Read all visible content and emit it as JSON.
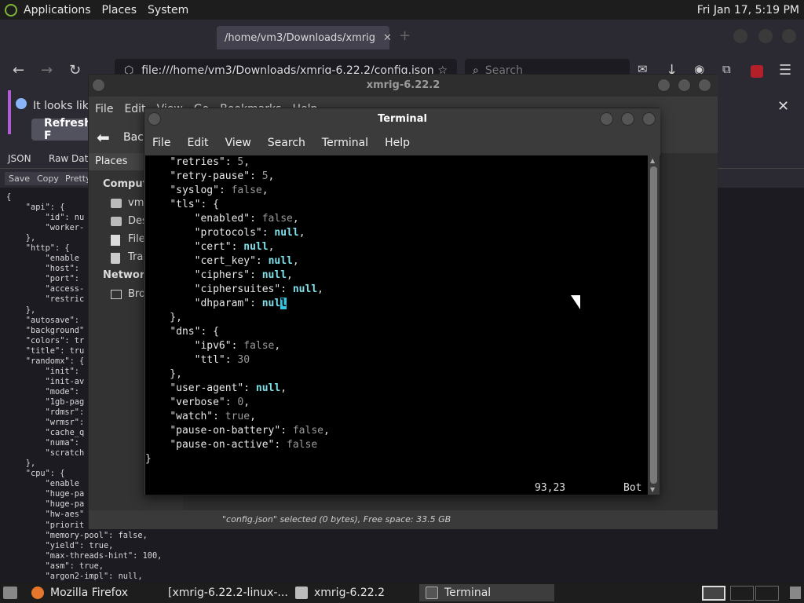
{
  "top_panel": {
    "menus": [
      "Applications",
      "Places",
      "System"
    ],
    "clock": "Fri Jan 17,  5:19 PM"
  },
  "firefox": {
    "tab_title": "/home/vm3/Downloads/xmrig",
    "url": "file:///home/vm3/Downloads/xmrig-6.22.2/config.json",
    "search_placeholder": "Search",
    "notify_text": "It looks like",
    "refresh_label": "Refresh F",
    "json_tabs": [
      "JSON",
      "Raw Data"
    ],
    "json_tools": [
      "Save",
      "Copy",
      "Pretty"
    ],
    "json_text": "{\n    \"api\": {\n        \"id\": nu\n        \"worker-\n    },\n    \"http\": {\n        \"enable\n        \"host\":\n        \"port\":\n        \"access-\n        \"restric\n    },\n    \"autosave\":\n    \"background\"\n    \"colors\": tr\n    \"title\": tru\n    \"randomx\": {\n        \"init\":\n        \"init-av\n        \"mode\":\n        \"1gb-pag\n        \"rdmsr\":\n        \"wrmsr\":\n        \"cache_q\n        \"numa\":\n        \"scratch\n    },\n    \"cpu\": {\n        \"enable\n        \"huge-pa\n        \"huge-pa\n        \"hw-aes\"\n        \"priorit\n        \"memory-pool\": false,\n        \"yield\": true,\n        \"max-threads-hint\": 100,\n        \"asm\": true,\n        \"argon2-impl\": null,"
  },
  "file_manager": {
    "title": "xmrig-6.22.2",
    "menus": [
      "File",
      "Edit",
      "View",
      "Go",
      "Bookmarks",
      "Help"
    ],
    "back_label": "Back",
    "sidebar_header": "Places",
    "computer_label": "Compute",
    "items": [
      "vm3",
      "Des",
      "File",
      "Tra"
    ],
    "network_label": "Network",
    "browse_label": "Bro",
    "status": "\"config.json\" selected (0 bytes), Free space: 33.5 GB"
  },
  "terminal": {
    "title": "Terminal",
    "menus": [
      "File",
      "Edit",
      "View",
      "Search",
      "Terminal",
      "Help"
    ],
    "position": "93,23",
    "scroll_state": "Bot"
  },
  "taskbar": {
    "items": [
      "Mozilla Firefox",
      "[xmrig-6.22.2-linux-...",
      "xmrig-6.22.2",
      "Terminal"
    ]
  }
}
